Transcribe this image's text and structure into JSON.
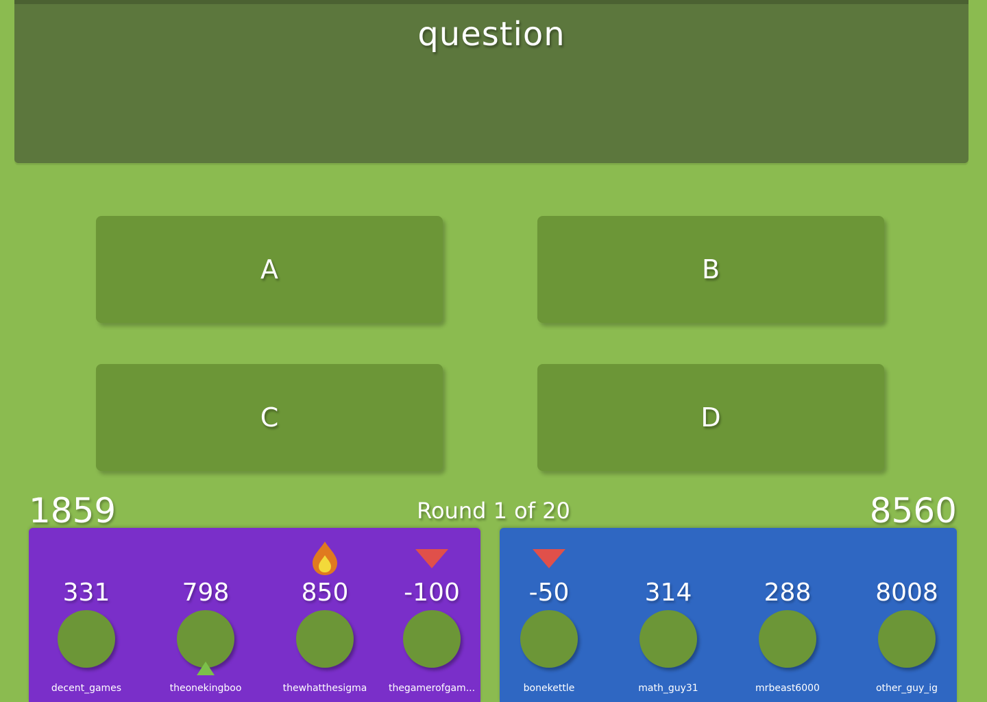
{
  "question": {
    "text": "question"
  },
  "answers": [
    {
      "label": "A"
    },
    {
      "label": "B"
    },
    {
      "label": "C"
    },
    {
      "label": "D"
    }
  ],
  "round": {
    "label": "Round 1 of 20"
  },
  "teams": [
    {
      "score": "1859",
      "color": "#7a2fc9",
      "players": [
        {
          "points": "331",
          "name": "decent_games",
          "status": "none"
        },
        {
          "points": "798",
          "name": "theonekingboo",
          "status": "up-arrow-icon"
        },
        {
          "points": "850",
          "name": "thewhatthesigma",
          "status": "flame-icon"
        },
        {
          "points": "-100",
          "name": "thegamerofgam...",
          "status": "down-arrow-icon"
        }
      ]
    },
    {
      "score": "8560",
      "color": "#2f67c2",
      "players": [
        {
          "points": "-50",
          "name": "bonekettle",
          "status": "down-arrow-icon"
        },
        {
          "points": "314",
          "name": "math_guy31",
          "status": "none"
        },
        {
          "points": "288",
          "name": "mrbeast6000",
          "status": "none"
        },
        {
          "points": "8008",
          "name": "other_guy_ig",
          "status": "none"
        }
      ]
    }
  ],
  "colors": {
    "background": "#8bbb50",
    "question_panel": "#5c773d",
    "answer_button": "#6c9637",
    "avatar": "#6c9637",
    "down_marker": "#e0504a",
    "up_marker": "#7cc04a",
    "flame_outer": "#e07a1f",
    "flame_inner": "#f3d93a"
  }
}
